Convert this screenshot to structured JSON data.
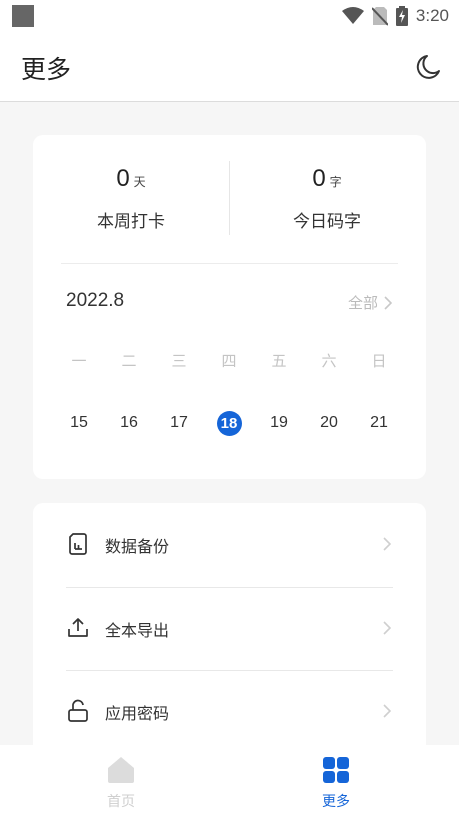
{
  "status_bar": {
    "time": "3:20",
    "icons": [
      "notification-square-icon",
      "wifi-icon",
      "no-sim-icon",
      "battery-charging-icon"
    ]
  },
  "header": {
    "title": "更多",
    "dark_mode_icon": "moon-icon"
  },
  "stats": {
    "week_checkin": {
      "value": "0",
      "unit": "天",
      "label": "本周打卡"
    },
    "today_words": {
      "value": "0",
      "unit": "字",
      "label": "今日码字"
    }
  },
  "calendar": {
    "month": "2022.8",
    "all_label": "全部",
    "weekdays": [
      "一",
      "二",
      "三",
      "四",
      "五",
      "六",
      "日"
    ],
    "dates": [
      "15",
      "16",
      "17",
      "18",
      "19",
      "20",
      "21"
    ],
    "today": "18",
    "accent_color": "#1565d8"
  },
  "menu": {
    "items": [
      {
        "label": "数据备份",
        "icon": "sd-card-icon"
      },
      {
        "label": "全本导出",
        "icon": "upload-icon"
      },
      {
        "label": "应用密码",
        "icon": "unlock-icon"
      }
    ]
  },
  "bottom_nav": {
    "items": [
      {
        "label": "首页",
        "icon": "home-icon",
        "active": false
      },
      {
        "label": "更多",
        "icon": "grid-icon",
        "active": true
      }
    ]
  }
}
